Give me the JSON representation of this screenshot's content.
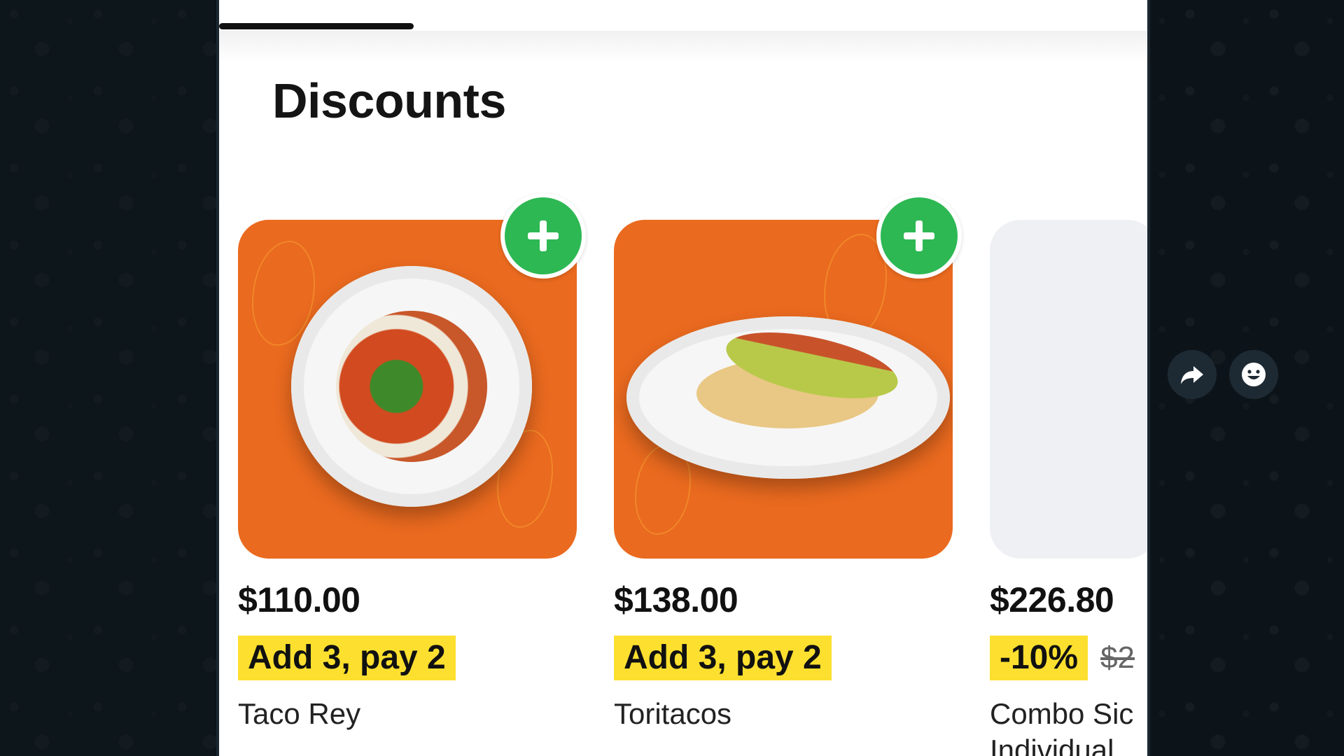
{
  "section": {
    "title": "Discounts"
  },
  "cards": [
    {
      "price": "$110.00",
      "promo": "Add 3, pay 2",
      "name": "Taco Rey",
      "image": "taco-plate-image"
    },
    {
      "price": "$138.00",
      "promo": "Add 3, pay 2",
      "name": "Toritacos",
      "image": "chile-tortilla-plate-image"
    },
    {
      "price": "$226.80",
      "promo": "-10%",
      "old_price": "$2",
      "name_line1": "Combo Sic",
      "name_line2": "Individual"
    }
  ],
  "side_actions": [
    {
      "icon": "forward-icon"
    },
    {
      "icon": "emoji-icon"
    }
  ],
  "colors": {
    "accent_orange": "#ea6a1f",
    "add_green": "#2db853",
    "promo_yellow": "#fde02f"
  }
}
